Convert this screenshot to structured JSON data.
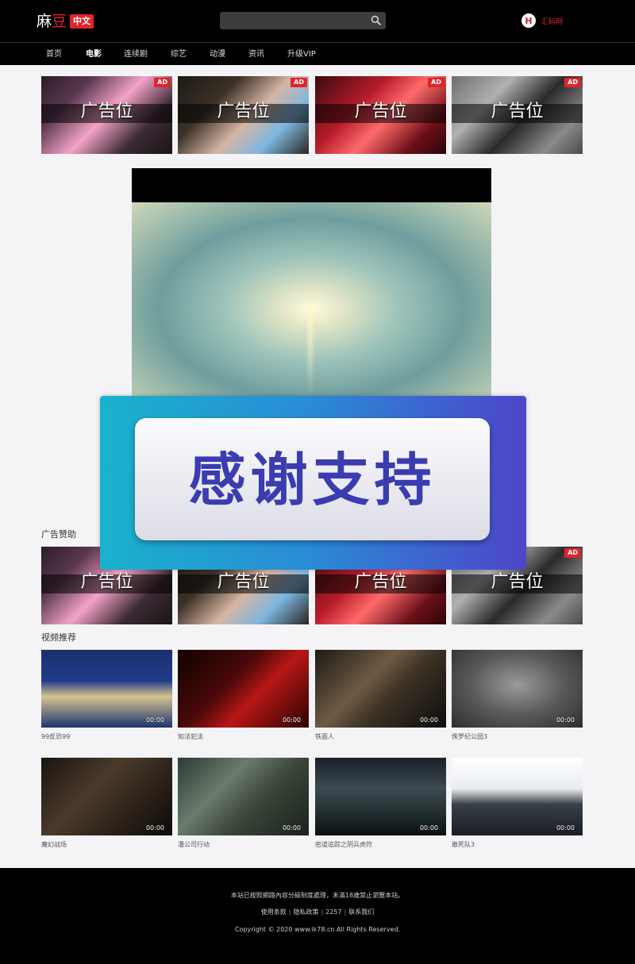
{
  "site": {
    "logo_part1": "麻",
    "logo_part2": "豆",
    "logo_badge": "中文"
  },
  "search": {
    "placeholder": ""
  },
  "user": {
    "avatar_letter": "H",
    "label": "汇码网"
  },
  "nav": {
    "items": [
      "首页",
      "电影",
      "连续剧",
      "综艺",
      "动漫",
      "资讯",
      "升级VIP"
    ],
    "active": "电影"
  },
  "ads_top": [
    {
      "text": "广告位",
      "badge": "AD"
    },
    {
      "text": "广告位",
      "badge": "AD"
    },
    {
      "text": "广告位",
      "badge": "AD"
    },
    {
      "text": "广告位",
      "badge": "AD"
    }
  ],
  "overlay": {
    "text": "感谢支持"
  },
  "ad_section": {
    "title": "广告赞助"
  },
  "ads_bottom": [
    {
      "text": "广告位",
      "badge": ""
    },
    {
      "text": "广告位",
      "badge": ""
    },
    {
      "text": "广告位",
      "badge": ""
    },
    {
      "text": "广告位",
      "badge": "AD"
    }
  ],
  "video_section": {
    "title": "视频推荐"
  },
  "movies": [
    {
      "title": "99反恐99",
      "duration": "00:00"
    },
    {
      "title": "知法犯法",
      "duration": "00:00"
    },
    {
      "title": "铁面人",
      "duration": "00:00"
    },
    {
      "title": "侏罗纪公园3",
      "duration": "00:00"
    },
    {
      "title": "魔幻战场",
      "duration": "00:00"
    },
    {
      "title": "潘公司行动",
      "duration": "00:00"
    },
    {
      "title": "密道追踪之阴兵虎符",
      "duration": "00:00"
    },
    {
      "title": "敢死队3",
      "duration": "00:00"
    }
  ],
  "footer": {
    "notice": "本站已按照網路內容分級制度處理，未滿18歲禁止瀏覽本站。",
    "links": [
      "使用条款",
      "隐私政策",
      "2257",
      "联系我们"
    ],
    "copyright": "Copyright © 2020 www.ik78.cn All Rights Reserved."
  },
  "colors": {
    "brand_red": "#e0242d",
    "header_bg": "#000000",
    "page_bg": "#f4f4f6",
    "overlay_text": "#3a3cb0"
  }
}
